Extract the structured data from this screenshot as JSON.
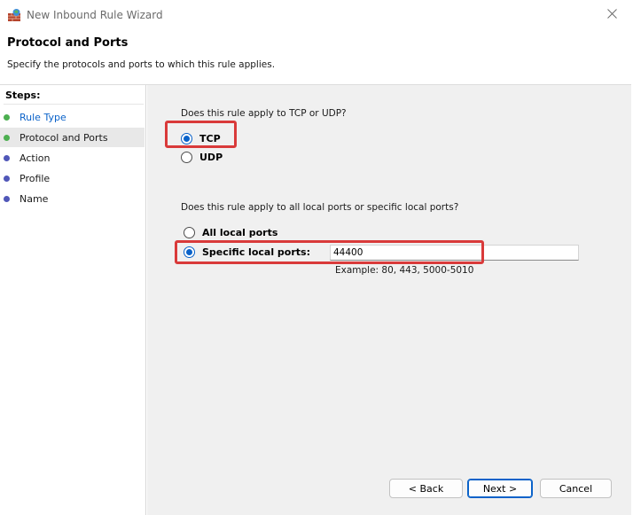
{
  "window": {
    "title": "New Inbound Rule Wizard"
  },
  "header": {
    "title": "Protocol and Ports",
    "subtitle": "Specify the protocols and ports to which this rule applies."
  },
  "steps": {
    "label": "Steps:",
    "items": [
      {
        "label": "Rule Type",
        "state": "done",
        "color": "#0a62c9",
        "dot": "#4caf50"
      },
      {
        "label": "Protocol and Ports",
        "state": "current",
        "color": "#1a1a1a",
        "dot": "#4caf50"
      },
      {
        "label": "Action",
        "state": "pending",
        "color": "#1a1a1a",
        "dot": "#5057b8"
      },
      {
        "label": "Profile",
        "state": "pending",
        "color": "#1a1a1a",
        "dot": "#5057b8"
      },
      {
        "label": "Name",
        "state": "pending",
        "color": "#1a1a1a",
        "dot": "#5057b8"
      }
    ]
  },
  "protocol": {
    "question": "Does this rule apply to TCP or UDP?",
    "options": [
      {
        "label": "TCP",
        "selected": true
      },
      {
        "label": "UDP",
        "selected": false
      }
    ]
  },
  "ports": {
    "question": "Does this rule apply to all local ports or specific local ports?",
    "options": [
      {
        "label": "All local ports",
        "selected": false
      },
      {
        "label": "Specific local ports:",
        "selected": true
      }
    ],
    "value": "44400",
    "example": "Example: 80, 443, 5000-5010"
  },
  "buttons": {
    "back": "< Back",
    "next": "Next >",
    "cancel": "Cancel"
  },
  "colors": {
    "accent": "#0a62c9",
    "highlight": "#d93a3a"
  }
}
